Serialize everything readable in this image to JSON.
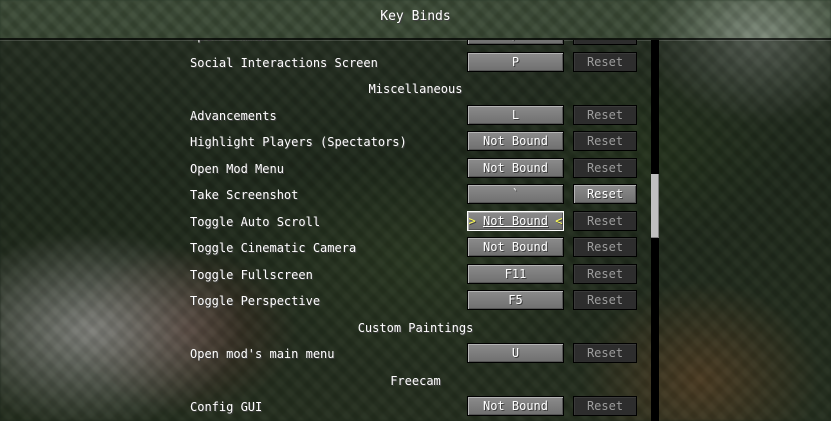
{
  "window": {
    "title": "Key Binds"
  },
  "rows": [
    {
      "kind": "bind",
      "label": "Open Command",
      "key": "/",
      "reset": "Reset",
      "reset_enabled": false
    },
    {
      "kind": "bind",
      "label": "Social Interactions Screen",
      "key": "P",
      "reset": "Reset",
      "reset_enabled": false
    },
    {
      "kind": "category",
      "label": "Miscellaneous"
    },
    {
      "kind": "bind",
      "label": "Advancements",
      "key": "L",
      "reset": "Reset",
      "reset_enabled": false
    },
    {
      "kind": "bind",
      "label": "Highlight Players (Spectators)",
      "key": "Not Bound",
      "reset": "Reset",
      "reset_enabled": false
    },
    {
      "kind": "bind",
      "label": "Open Mod Menu",
      "key": "Not Bound",
      "reset": "Reset",
      "reset_enabled": false
    },
    {
      "kind": "bind",
      "label": "Take Screenshot",
      "key": "`",
      "reset": "Reset",
      "reset_enabled": true
    },
    {
      "kind": "bind",
      "label": "Toggle Auto Scroll",
      "key": "Not Bound",
      "reset": "Reset",
      "reset_enabled": false,
      "hovered": true,
      "arrow_left": ">",
      "arrow_right": "<"
    },
    {
      "kind": "bind",
      "label": "Toggle Cinematic Camera",
      "key": "Not Bound",
      "reset": "Reset",
      "reset_enabled": false
    },
    {
      "kind": "bind",
      "label": "Toggle Fullscreen",
      "key": "F11",
      "reset": "Reset",
      "reset_enabled": false
    },
    {
      "kind": "bind",
      "label": "Toggle Perspective",
      "key": "F5",
      "reset": "Reset",
      "reset_enabled": false
    },
    {
      "kind": "category",
      "label": "Custom Paintings"
    },
    {
      "kind": "bind",
      "label": "Open mod's main menu",
      "key": "U",
      "reset": "Reset",
      "reset_enabled": false
    },
    {
      "kind": "category",
      "label": "Freecam"
    },
    {
      "kind": "bind",
      "label": "Config GUI",
      "key": "Not Bound",
      "reset": "Reset",
      "reset_enabled": false
    }
  ]
}
